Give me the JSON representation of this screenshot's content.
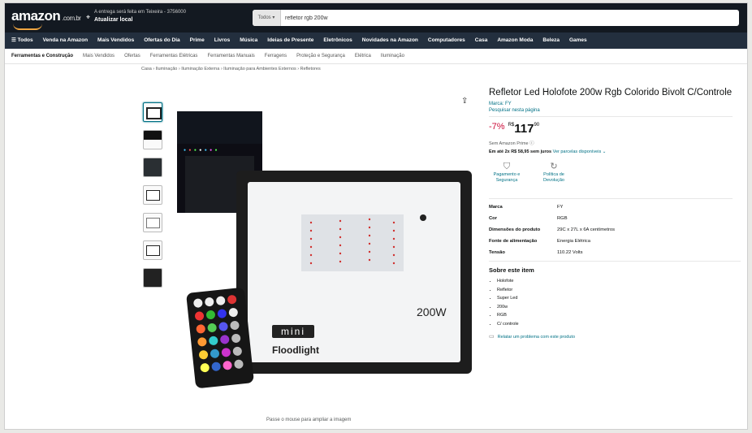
{
  "header": {
    "logo": "amazon",
    "logo_domain": ".com.br",
    "deliver_line1": "A entrega será feita em Teixeira - 3756000",
    "deliver_line2": "Atualizar local",
    "search_category": "Todos",
    "search_value": "refletor rgb 200w"
  },
  "navbar": [
    "☰ Todos",
    "Venda na Amazon",
    "Mais Vendidos",
    "Ofertas do Dia",
    "Prime",
    "Livros",
    "Música",
    "Ideias de Presente",
    "Eletrônicos",
    "Novidades na Amazon",
    "Computadores",
    "Casa",
    "Amazon Moda",
    "Beleza",
    "Games"
  ],
  "subnav": [
    "Ferramentas e Construção",
    "Mais Vendidos",
    "Ofertas",
    "Ferramentas Elétricas",
    "Ferramentas Manuais",
    "Ferragens",
    "Proteção e Segurança",
    "Elétrica",
    "Iluminação"
  ],
  "breadcrumb": "Casa › Iluminação › Iluminação Externa › Iluminação para Ambientes Externos › Refletores",
  "image": {
    "label_200w": "200W",
    "label_mini": "mini",
    "label_floodlight": "Floodlight",
    "hint": "Passe o mouse para ampliar a imagem"
  },
  "product": {
    "title": "Refletor Led Holofote 200w Rgb Colorido Bivolt C/Controle",
    "brand": "Marca: FY",
    "search_page": "Pesquisar nesta página",
    "discount": "-7%",
    "currency": "R$",
    "price": "117",
    "cents": "90",
    "prime_line": "Sem Amazon Prime ⓘ",
    "install_text": "Em até 2x R$ 58,95 sem juros",
    "install_link": "Ver parcelas disponíveis ⌄",
    "badges": [
      "Pagamento e Segurança",
      "Política de Devolução"
    ]
  },
  "specs": [
    {
      "k": "Marca",
      "v": "FY"
    },
    {
      "k": "Cor",
      "v": "RGB"
    },
    {
      "k": "Dimensões do produto",
      "v": "29C x 27L x 6A centímetros"
    },
    {
      "k": "Fonte de alimentação",
      "v": "Energia Elétrica"
    },
    {
      "k": "Tensão",
      "v": "110.22 Volts"
    }
  ],
  "about": {
    "heading": "Sobre este item",
    "items": [
      "Holofote",
      "Refletor",
      "Super Led",
      "200w",
      "RGB",
      "C/ controle"
    ]
  },
  "report": "Relatar um problema com este produto",
  "colors": {
    "header_bg": "#131921",
    "nav_bg": "#232f3e",
    "link": "#007185",
    "discount": "#cc0c39"
  }
}
